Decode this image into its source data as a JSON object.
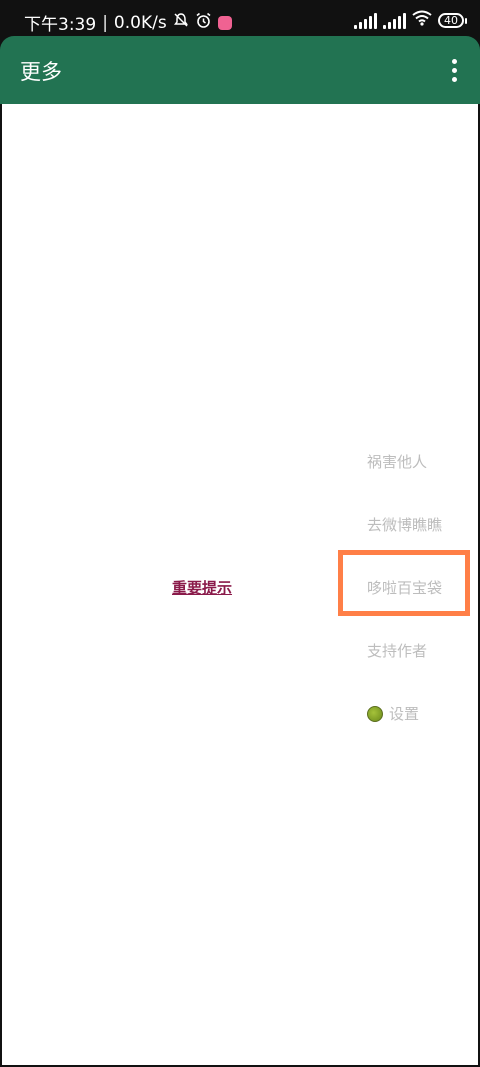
{
  "status_bar": {
    "time": "下午3:39",
    "separator": "|",
    "net_speed": "0.0K/s",
    "battery_level": "40",
    "icons": [
      "mute-icon",
      "alarm-icon",
      "app-notification-icon",
      "signal-icon",
      "signal-icon",
      "wifi-icon",
      "battery-icon"
    ]
  },
  "app_bar": {
    "title": "更多",
    "overflow_icon": "more-vert-icon",
    "color": "#227352"
  },
  "main": {
    "notice_link": "重要提示",
    "notice_color": "#8a1a4a"
  },
  "menu": {
    "items": [
      {
        "label": "祸害他人"
      },
      {
        "label": "去微博瞧瞧"
      },
      {
        "label": "哆啦百宝袋"
      },
      {
        "label": "支持作者"
      },
      {
        "label": "设置",
        "icon": "leaf-icon"
      }
    ],
    "text_color": "#bdbdbd",
    "highlight_color": "#ff7f47"
  }
}
